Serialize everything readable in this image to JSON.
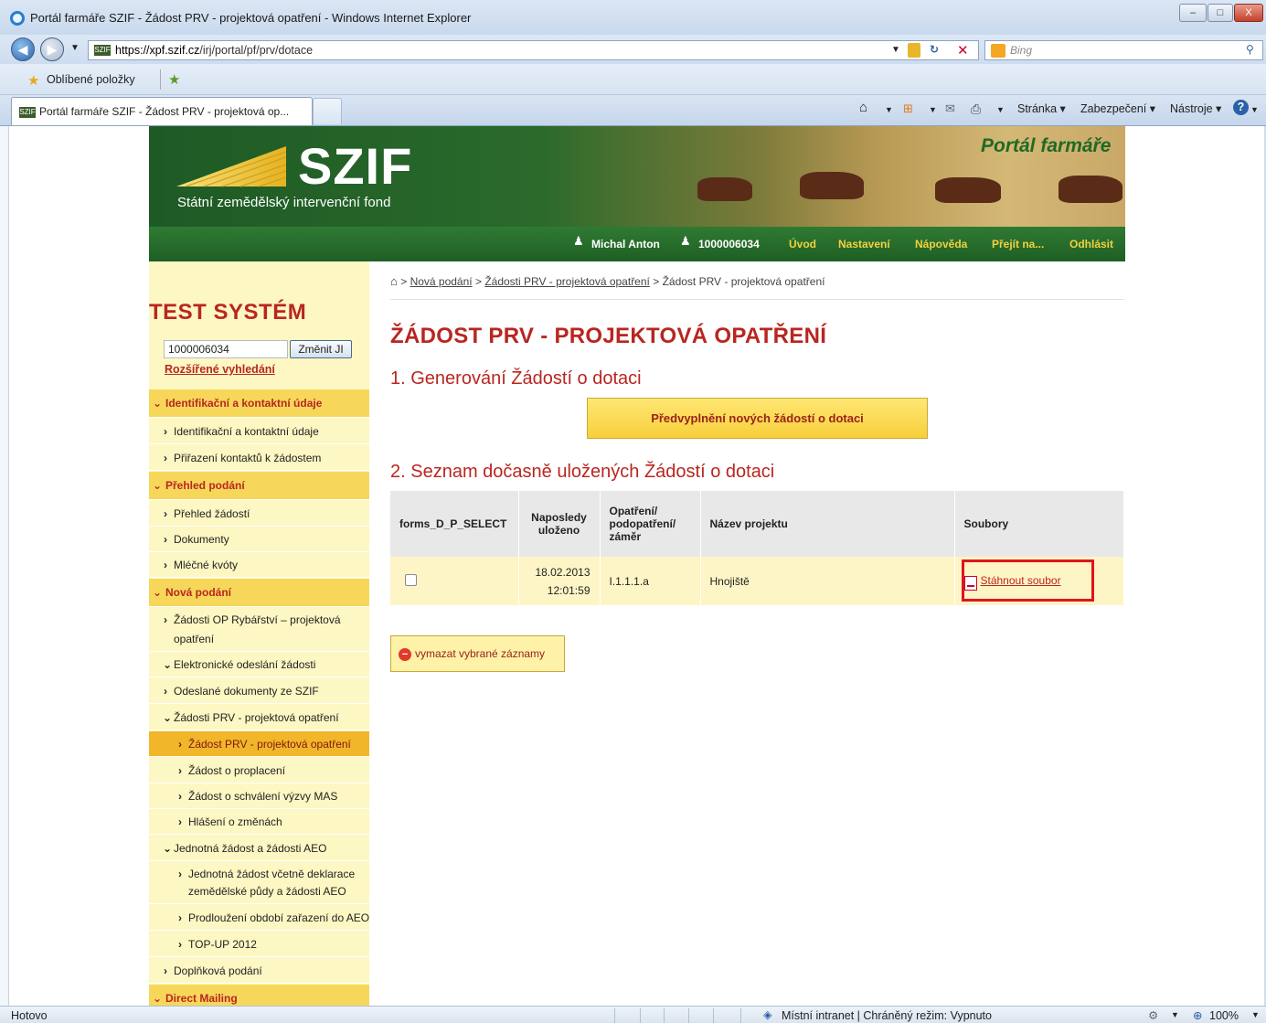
{
  "browser": {
    "window_title": "Portál farmáře SZIF - Žádost PRV - projektová opatření - Windows Internet Explorer",
    "window_buttons": [
      "–",
      "□",
      "X"
    ],
    "url_host": "https://xpf.szif.cz",
    "url_path": "/irj/portal/pf/prv/dotace",
    "search_placeholder": "Bing",
    "favorites_label": "Oblíbené položky",
    "tab_title": "Portál farmáře SZIF - Žádost PRV - projektová op...",
    "commands": {
      "page": "Stránka ▾",
      "security": "Zabezpečení ▾",
      "tools": "Nástroje ▾"
    },
    "status_text": "Hotovo",
    "zone_text": "Místní intranet | Chráněný režim: Vypnuto",
    "zoom": "100%"
  },
  "banner": {
    "logo_text": "SZIF",
    "logo_subtitle": "Státní zemědělský intervenční fond",
    "portal_title": "Portál farmáře"
  },
  "topnav": {
    "user_name": "Michal Anton",
    "client_id": "1000006034",
    "links": [
      "Úvod",
      "Nastavení",
      "Nápověda",
      "Přejít na...",
      "Odhlásit"
    ]
  },
  "sidebar": {
    "system_label": "TEST SYSTÉM",
    "search_value": "1000006034",
    "change_button": "Změnit JI",
    "advanced_search": "Rozšířené vyhledání",
    "items": [
      "Identifikační a kontaktní údaje",
      "Identifikační a kontaktní údaje",
      "Přiřazení kontaktů k žádostem",
      "Přehled podání",
      "Přehled žádostí",
      "Dokumenty",
      "Mléčné kvóty",
      "Nová podání",
      "Žádosti OP Rybářství – projektová",
      "opatření",
      "Elektronické odeslání žádosti",
      "Odeslané dokumenty ze SZIF",
      "Žádosti PRV - projektová opatření",
      "Žádost PRV - projektová opatření",
      "Žádost o proplacení",
      "Žádost o schválení výzvy MAS",
      "Hlášení o změnách",
      "Jednotná žádost a žádosti AEO",
      "Jednotná žádost včetně deklarace",
      "zemědělské půdy a žádosti AEO",
      "Prodloužení období zařazení do AEO",
      "TOP-UP 2012",
      "Doplňková podání",
      "Direct Mailing"
    ]
  },
  "breadcrumb": {
    "items": [
      "Nová podání",
      "Žádosti PRV - projektová opatření",
      "Žádost PRV - projektová opatření"
    ],
    "separator": ">"
  },
  "main": {
    "title": "ŽÁDOST PRV - PROJEKTOVÁ OPATŘENÍ",
    "section1": "1. Generování Žádostí o dotaci",
    "generate_button": "Předvyplnění nových žádostí o dotaci",
    "section2": "2. Seznam dočasně uložených Žádostí o dotaci",
    "table": {
      "headers": [
        "forms_D_P_SELECT",
        "Naposledy uloženo",
        "Opatření/ podopatření/ záměr",
        "Název projektu",
        "Soubory"
      ],
      "rows": [
        {
          "date": "18.02.2013",
          "time": "12:01:59",
          "measure": "I.1.1.1.a",
          "project": "Hnojiště",
          "file_link": "Stáhnout soubor"
        }
      ]
    },
    "delete_button": "vymazat vybrané záznamy"
  },
  "colors": {
    "accent_red": "#b92620",
    "sidebar_bg": "#fdf7c3",
    "nav_green": "#1f5f24",
    "highlight": "#e0141d"
  }
}
